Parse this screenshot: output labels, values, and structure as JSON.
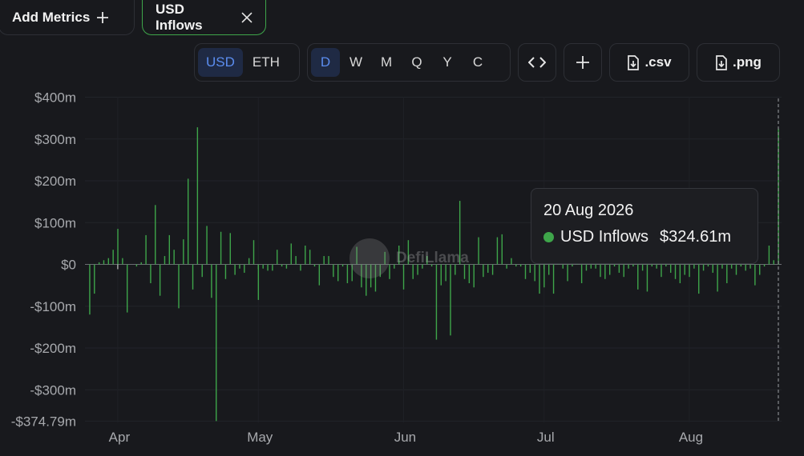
{
  "toolbar": {
    "add_metrics_label": "Add Metrics",
    "add_icon": "plus-icon",
    "metric_chip_label": "USD Inflows",
    "close_icon": "close-icon",
    "currency_options": [
      "USD",
      "ETH"
    ],
    "currency_selected": "USD",
    "granularity_options": [
      "D",
      "W",
      "M",
      "Q",
      "Y",
      "C"
    ],
    "granularity_selected": "D",
    "embed_icon": "code-icon",
    "add_chart_icon": "plus-icon",
    "csv_label": ".csv",
    "png_label": ".png",
    "download_icon": "file-download-icon"
  },
  "watermark": {
    "text": "DefiLlama"
  },
  "tooltip": {
    "date": "20 Aug 2026",
    "series": "USD Inflows",
    "value": "$324.61m"
  },
  "colors": {
    "accent": "#3ea54a",
    "background": "#18191d",
    "selected": "#5b8def"
  },
  "chart_data": {
    "type": "bar",
    "series": [
      {
        "name": "USD Inflows",
        "color": "#3ea54a"
      }
    ],
    "ylim": [
      -374.79,
      400
    ],
    "yticks": [
      400,
      300,
      200,
      100,
      0,
      -100,
      -200,
      -300,
      -374.79
    ],
    "ytick_labels": [
      "$400m",
      "$300m",
      "$200m",
      "$100m",
      "$0",
      "-$100m",
      "-$200m",
      "-$300m",
      "-$374.79m"
    ],
    "xlim": [
      "2026-03-25",
      "2026-08-20"
    ],
    "xtick_labels": [
      {
        "date": "2026-04-01",
        "label": "Apr"
      },
      {
        "date": "2026-05-01",
        "label": "May"
      },
      {
        "date": "2026-06-01",
        "label": "Jun"
      },
      {
        "date": "2026-07-01",
        "label": "Jul"
      },
      {
        "date": "2026-08-01",
        "label": "Aug"
      }
    ],
    "grid": true,
    "highlight_date": "2026-08-20",
    "points": [
      [
        "2026-03-26",
        -120
      ],
      [
        "2026-03-27",
        -70
      ],
      [
        "2026-03-28",
        5
      ],
      [
        "2026-03-29",
        10
      ],
      [
        "2026-03-30",
        15
      ],
      [
        "2026-03-31",
        35
      ],
      [
        "2026-04-01",
        85
      ],
      [
        "2026-04-02",
        15
      ],
      [
        "2026-04-03",
        -115
      ],
      [
        "2026-04-05",
        -5
      ],
      [
        "2026-04-06",
        5
      ],
      [
        "2026-04-07",
        70
      ],
      [
        "2026-04-08",
        -45
      ],
      [
        "2026-04-09",
        142
      ],
      [
        "2026-04-10",
        -75
      ],
      [
        "2026-04-11",
        20
      ],
      [
        "2026-04-12",
        70
      ],
      [
        "2026-04-13",
        35
      ],
      [
        "2026-04-14",
        -105
      ],
      [
        "2026-04-15",
        60
      ],
      [
        "2026-04-16",
        205
      ],
      [
        "2026-04-17",
        -60
      ],
      [
        "2026-04-18",
        328
      ],
      [
        "2026-04-19",
        -30
      ],
      [
        "2026-04-20",
        92
      ],
      [
        "2026-04-21",
        -80
      ],
      [
        "2026-04-22",
        -374.79
      ],
      [
        "2026-04-23",
        78
      ],
      [
        "2026-04-24",
        -35
      ],
      [
        "2026-04-25",
        75
      ],
      [
        "2026-04-26",
        -25
      ],
      [
        "2026-04-27",
        -10
      ],
      [
        "2026-04-28",
        -20
      ],
      [
        "2026-04-29",
        15
      ],
      [
        "2026-04-30",
        58
      ],
      [
        "2026-05-01",
        -85
      ],
      [
        "2026-05-02",
        -10
      ],
      [
        "2026-05-03",
        -15
      ],
      [
        "2026-05-04",
        -15
      ],
      [
        "2026-05-05",
        35
      ],
      [
        "2026-05-06",
        -5
      ],
      [
        "2026-05-07",
        -10
      ],
      [
        "2026-05-08",
        50
      ],
      [
        "2026-05-09",
        20
      ],
      [
        "2026-05-10",
        -15
      ],
      [
        "2026-05-11",
        45
      ],
      [
        "2026-05-12",
        35
      ],
      [
        "2026-05-13",
        -5
      ],
      [
        "2026-05-14",
        -50
      ],
      [
        "2026-05-15",
        20
      ],
      [
        "2026-05-16",
        20
      ],
      [
        "2026-05-17",
        -30
      ],
      [
        "2026-05-18",
        -40
      ],
      [
        "2026-05-19",
        -5
      ],
      [
        "2026-05-20",
        -45
      ],
      [
        "2026-05-21",
        -40
      ],
      [
        "2026-05-22",
        42
      ],
      [
        "2026-05-23",
        -55
      ],
      [
        "2026-05-24",
        -75
      ],
      [
        "2026-05-25",
        -55
      ],
      [
        "2026-05-26",
        -65
      ],
      [
        "2026-05-27",
        -30
      ],
      [
        "2026-05-28",
        30
      ],
      [
        "2026-05-29",
        -35
      ],
      [
        "2026-05-30",
        -10
      ],
      [
        "2026-05-31",
        45
      ],
      [
        "2026-06-01",
        -60
      ],
      [
        "2026-06-02",
        58
      ],
      [
        "2026-06-03",
        -35
      ],
      [
        "2026-06-04",
        -25
      ],
      [
        "2026-06-05",
        -10
      ],
      [
        "2026-06-06",
        20
      ],
      [
        "2026-06-07",
        -5
      ],
      [
        "2026-06-08",
        -180
      ],
      [
        "2026-06-09",
        -50
      ],
      [
        "2026-06-10",
        -40
      ],
      [
        "2026-06-11",
        -170
      ],
      [
        "2026-06-12",
        -25
      ],
      [
        "2026-06-13",
        152
      ],
      [
        "2026-06-14",
        -35
      ],
      [
        "2026-06-15",
        -45
      ],
      [
        "2026-06-16",
        -55
      ],
      [
        "2026-06-17",
        65
      ],
      [
        "2026-06-18",
        -30
      ],
      [
        "2026-06-19",
        -20
      ],
      [
        "2026-06-20",
        -25
      ],
      [
        "2026-06-21",
        65
      ],
      [
        "2026-06-22",
        72
      ],
      [
        "2026-06-23",
        -10
      ],
      [
        "2026-06-24",
        15
      ],
      [
        "2026-06-25",
        -5
      ],
      [
        "2026-06-26",
        -5
      ],
      [
        "2026-06-27",
        -35
      ],
      [
        "2026-06-28",
        -20
      ],
      [
        "2026-06-29",
        -40
      ],
      [
        "2026-06-30",
        -70
      ],
      [
        "2026-07-01",
        -55
      ],
      [
        "2026-07-02",
        -25
      ],
      [
        "2026-07-03",
        -70
      ],
      [
        "2026-07-04",
        25
      ],
      [
        "2026-07-05",
        -10
      ],
      [
        "2026-07-06",
        -40
      ],
      [
        "2026-07-07",
        -5
      ],
      [
        "2026-07-08",
        10
      ],
      [
        "2026-07-09",
        -45
      ],
      [
        "2026-07-10",
        -15
      ],
      [
        "2026-07-11",
        -10
      ],
      [
        "2026-07-12",
        -10
      ],
      [
        "2026-07-13",
        -30
      ],
      [
        "2026-07-14",
        -35
      ],
      [
        "2026-07-15",
        -25
      ],
      [
        "2026-07-16",
        -5
      ],
      [
        "2026-07-17",
        -20
      ],
      [
        "2026-07-18",
        -30
      ],
      [
        "2026-07-19",
        -10
      ],
      [
        "2026-07-20",
        -5
      ],
      [
        "2026-07-21",
        -60
      ],
      [
        "2026-07-22",
        -15
      ],
      [
        "2026-07-23",
        -65
      ],
      [
        "2026-07-24",
        -5
      ],
      [
        "2026-07-25",
        -10
      ],
      [
        "2026-07-26",
        -30
      ],
      [
        "2026-07-27",
        -5
      ],
      [
        "2026-07-28",
        -20
      ],
      [
        "2026-07-29",
        -35
      ],
      [
        "2026-07-30",
        -45
      ],
      [
        "2026-07-31",
        -25
      ],
      [
        "2026-08-01",
        -30
      ],
      [
        "2026-08-02",
        -10
      ],
      [
        "2026-08-03",
        -70
      ],
      [
        "2026-08-04",
        -15
      ],
      [
        "2026-08-05",
        -5
      ],
      [
        "2026-08-06",
        -20
      ],
      [
        "2026-08-07",
        -65
      ],
      [
        "2026-08-08",
        -10
      ],
      [
        "2026-08-09",
        -45
      ],
      [
        "2026-08-10",
        -10
      ],
      [
        "2026-08-11",
        -25
      ],
      [
        "2026-08-12",
        -5
      ],
      [
        "2026-08-13",
        -15
      ],
      [
        "2026-08-14",
        -10
      ],
      [
        "2026-08-15",
        -50
      ],
      [
        "2026-08-16",
        -25
      ],
      [
        "2026-08-17",
        -5
      ],
      [
        "2026-08-18",
        45
      ],
      [
        "2026-08-19",
        10
      ],
      [
        "2026-08-20",
        324.61
      ]
    ]
  }
}
